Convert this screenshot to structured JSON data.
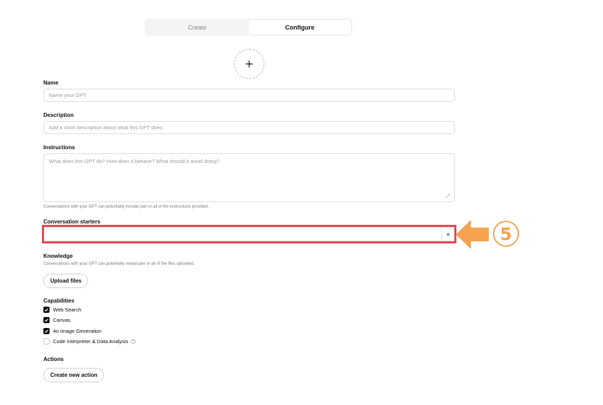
{
  "tabs": [
    {
      "label": "Create",
      "active": false
    },
    {
      "label": "Configure",
      "active": true
    }
  ],
  "avatar": {
    "icon": "plus-icon"
  },
  "name": {
    "label": "Name",
    "placeholder": "Name your GPT",
    "value": ""
  },
  "description": {
    "label": "Description",
    "placeholder": "Add a short description about what this GPT does",
    "value": ""
  },
  "instructions": {
    "label": "Instructions",
    "placeholder": "What does this GPT do? How does it behave? What should it avoid doing?",
    "value": "",
    "hint": "Conversations with your GPT can potentially include part or all of the instructions provided.",
    "resize_icon": "expand-icon"
  },
  "conversation_starters": {
    "label": "Conversation starters",
    "value": "",
    "clear_symbol": "×",
    "annotation": {
      "step": "5",
      "highlight_color": "#e8454f",
      "arrow_color": "#f5a34e"
    }
  },
  "knowledge": {
    "label": "Knowledge",
    "hint": "Conversations with your GPT can potentially reveal part or all of the files uploaded.",
    "upload_label": "Upload files"
  },
  "capabilities": {
    "label": "Capabilities",
    "items": [
      {
        "label": "Web Search",
        "checked": true
      },
      {
        "label": "Canvas",
        "checked": true
      },
      {
        "label": "4o Image Generation",
        "checked": true
      },
      {
        "label": "Code Interpreter & Data Analysis",
        "checked": false,
        "info_icon": "?"
      }
    ]
  },
  "actions": {
    "label": "Actions",
    "create_label": "Create new action"
  }
}
